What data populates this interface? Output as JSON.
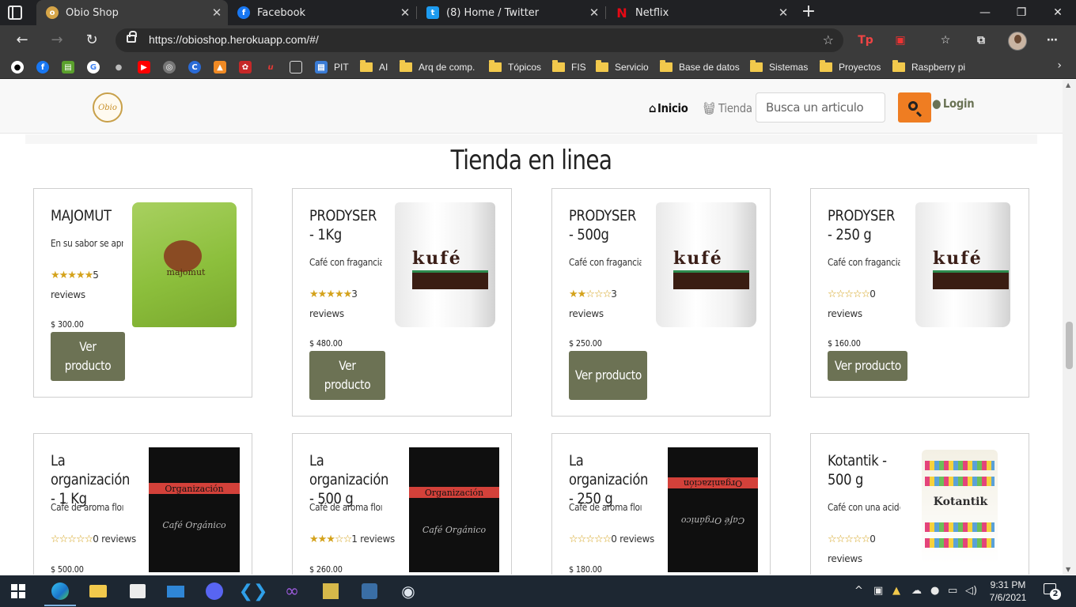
{
  "browser": {
    "tabs": [
      {
        "title": "Obio Shop",
        "icon": "obio-shop-favicon",
        "active": true
      },
      {
        "title": "Facebook",
        "icon": "facebook-icon",
        "active": false
      },
      {
        "title": "(8) Home / Twitter",
        "icon": "twitter-icon",
        "active": false
      },
      {
        "title": "Netflix",
        "icon": "netflix-icon",
        "active": false
      }
    ],
    "url": "https://obioshop.herokuapp.com/#/",
    "bookmarks": {
      "pit": "PIT",
      "ai": "AI",
      "arq": "Arq de comp.",
      "topicos": "Tópicos",
      "fis": "FIS",
      "servicio": "Servicio",
      "bd": "Base de datos",
      "sistemas": "Sistemas",
      "proyectos": "Proyectos",
      "raspberry": "Raspberry pi"
    }
  },
  "site": {
    "logo_text": "Obio",
    "nav": {
      "home": "Inicio",
      "shop": "Tienda",
      "login": "Login"
    },
    "search_placeholder": "Busca un articulo",
    "page_title": "Tienda en linea"
  },
  "colors": {
    "accent": "#ef7d22",
    "button": "#6c7254",
    "stars": "#d4a21b"
  },
  "products": [
    {
      "name": "MAJOMUT",
      "desc": "En su sabor se aprec",
      "stars": "★★★★★",
      "reviews_count": "5",
      "reviews_label": "reviews",
      "price": "$ 300.00",
      "button_label": "Ver producto"
    },
    {
      "name": "PRODYSER - 1Kg",
      "desc": "Café con fragancia c",
      "stars": "★★★★★",
      "reviews_count": "3",
      "reviews_label": "reviews",
      "price": "$ 480.00",
      "button_label": "Ver producto"
    },
    {
      "name": "PRODYSER - 500g",
      "desc": "Café con fragancia c",
      "stars": "★★☆☆☆",
      "reviews_count": "3",
      "reviews_label": "reviews",
      "price": "$ 250.00",
      "button_label": "Ver producto"
    },
    {
      "name": "PRODYSER - 250 g",
      "desc": "Café con fragancia c",
      "stars": "☆☆☆☆☆",
      "reviews_count": "0",
      "reviews_label": "reviews",
      "price": "$ 160.00",
      "button_label": "Ver producto"
    },
    {
      "name": "La organización - 1 Kg",
      "desc": "Café de aroma florar",
      "stars": "☆☆☆☆☆",
      "reviews_text": "0 reviews",
      "price": "$ 500.00"
    },
    {
      "name": "La organización - 500 g",
      "desc": "Café de aroma florar",
      "stars": "★★★☆☆",
      "reviews_text": "1 reviews",
      "price": "$ 260.00"
    },
    {
      "name": "La organización - 250 g",
      "desc": "Café de aroma florar",
      "stars": "☆☆☆☆☆",
      "reviews_text": "0 reviews",
      "price": "$ 180.00"
    },
    {
      "name": "Kotantik - 500 g",
      "desc": "Café con una acidez",
      "stars": "☆☆☆☆☆",
      "reviews_count": "0",
      "reviews_label": "reviews"
    }
  ],
  "product_images": {
    "majomut_label": "majomut",
    "prodyser_brand": "kufé",
    "organizacion_label": "Organización",
    "organizacion_script": "Café Orgánico",
    "kotantik_brand": "Kotantik"
  },
  "taskbar": {
    "time": "9:31 PM",
    "date": "7/6/2021",
    "notifications": "2"
  }
}
